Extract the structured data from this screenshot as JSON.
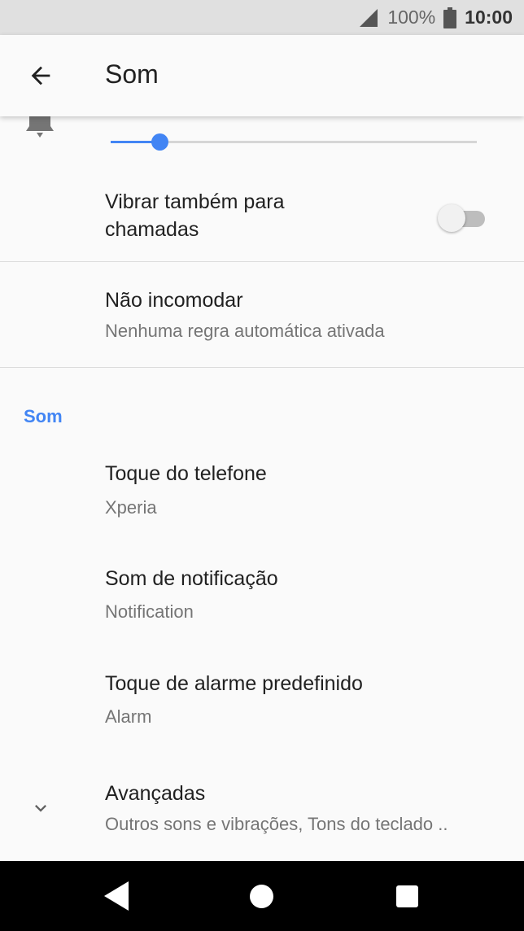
{
  "status_bar": {
    "battery_percent": "100%",
    "time": "10:00",
    "icons": [
      "signal-icon",
      "battery-icon"
    ]
  },
  "app_bar": {
    "title": "Som",
    "back_icon": "arrow-left-icon"
  },
  "ring_volume": {
    "icon": "bell-icon",
    "level": 0.134,
    "accent_color": "#4285f4"
  },
  "vibrate": {
    "label": "Vibrar também para chamadas",
    "enabled": false
  },
  "do_not_disturb": {
    "title": "Não incomodar",
    "summary": "Nenhuma regra automática ativada"
  },
  "sound_section": {
    "header": "Som",
    "items": [
      {
        "title": "Toque do telefone",
        "summary": "Xperia"
      },
      {
        "title": "Som de notificação",
        "summary": "Notification"
      },
      {
        "title": "Toque de alarme predefinido",
        "summary": "Alarm"
      }
    ]
  },
  "advanced": {
    "title": "Avançadas",
    "summary": "Outros sons e vibrações, Tons do teclado ..",
    "icon": "chevron-down-icon"
  },
  "nav_bar": {
    "icons": [
      "nav-back-icon",
      "nav-home-icon",
      "nav-recents-icon"
    ]
  }
}
